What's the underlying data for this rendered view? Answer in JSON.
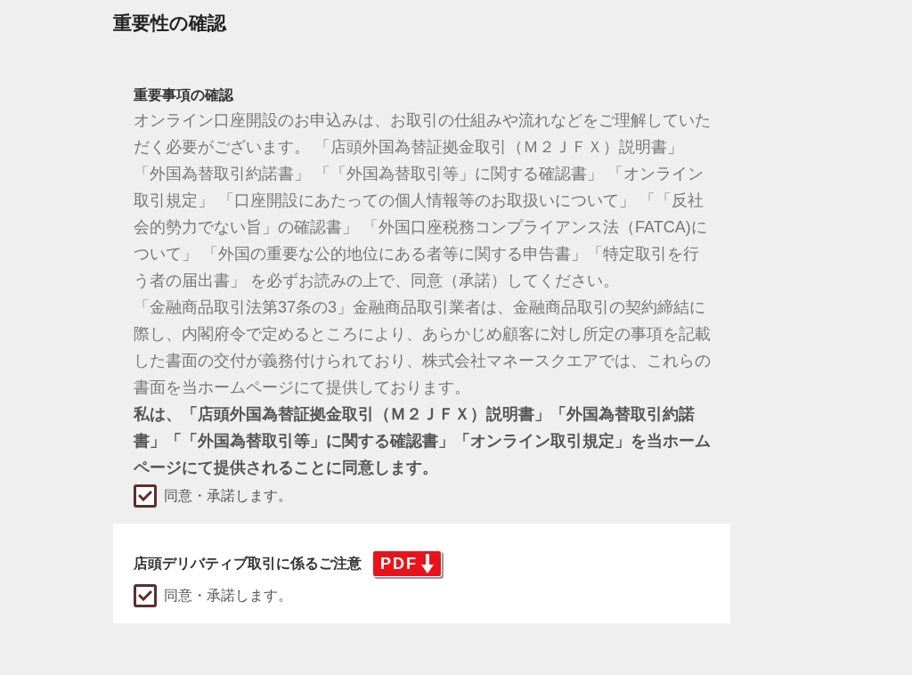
{
  "title": "重要性の確認",
  "section": {
    "heading": "重要事項の確認",
    "paragraphs": [
      {
        "text": "オンライン口座開設のお申込みは、お取引の仕組みや流れなどをご理解していただく必要がございます。 「店頭外国為替証拠金取引（Ｍ２ＪＦＸ）説明書」「外国為替取引約諾書」 「「外国為替取引等」に関する確認書」 「オンライン取引規定」 「口座開設にあたっての個人情報等のお取扱いについて」 「「反社会的勢力でない旨」の確認書」 「外国口座税務コンプライアンス法（FATCA)について」 「外国の重要な公的地位にある者等に関する申告書」「特定取引を行う者の届出書」 を必ずお読みの上で、同意（承諾）してください。",
        "bold": false
      },
      {
        "text": "「金融商品取引法第37条の3」金融商品取引業者は、金融商品取引の契約締結に際し、内閣府令で定めるところにより、あらかじめ顧客に対し所定の事項を記載した書面の交付が義務付けられており、株式会社マネースクエアでは、これらの書面を当ホームページにて提供しております。",
        "bold": false
      },
      {
        "text": "私は、「店頭外国為替証拠金取引（Ｍ２ＪＦＸ）説明書」「外国為替取引約諾書」「「外国為替取引等」に関する確認書」「オンライン取引規定」を当ホームページにて提供されることに同意します。",
        "bold": true
      }
    ],
    "agree": {
      "label": "同意・承諾します。",
      "checked": true
    }
  },
  "card": {
    "heading": "店頭デリバティブ取引に係るご注意",
    "pdf_badge": "PDF",
    "agree": {
      "label": "同意・承諾します。",
      "checked": true
    }
  }
}
